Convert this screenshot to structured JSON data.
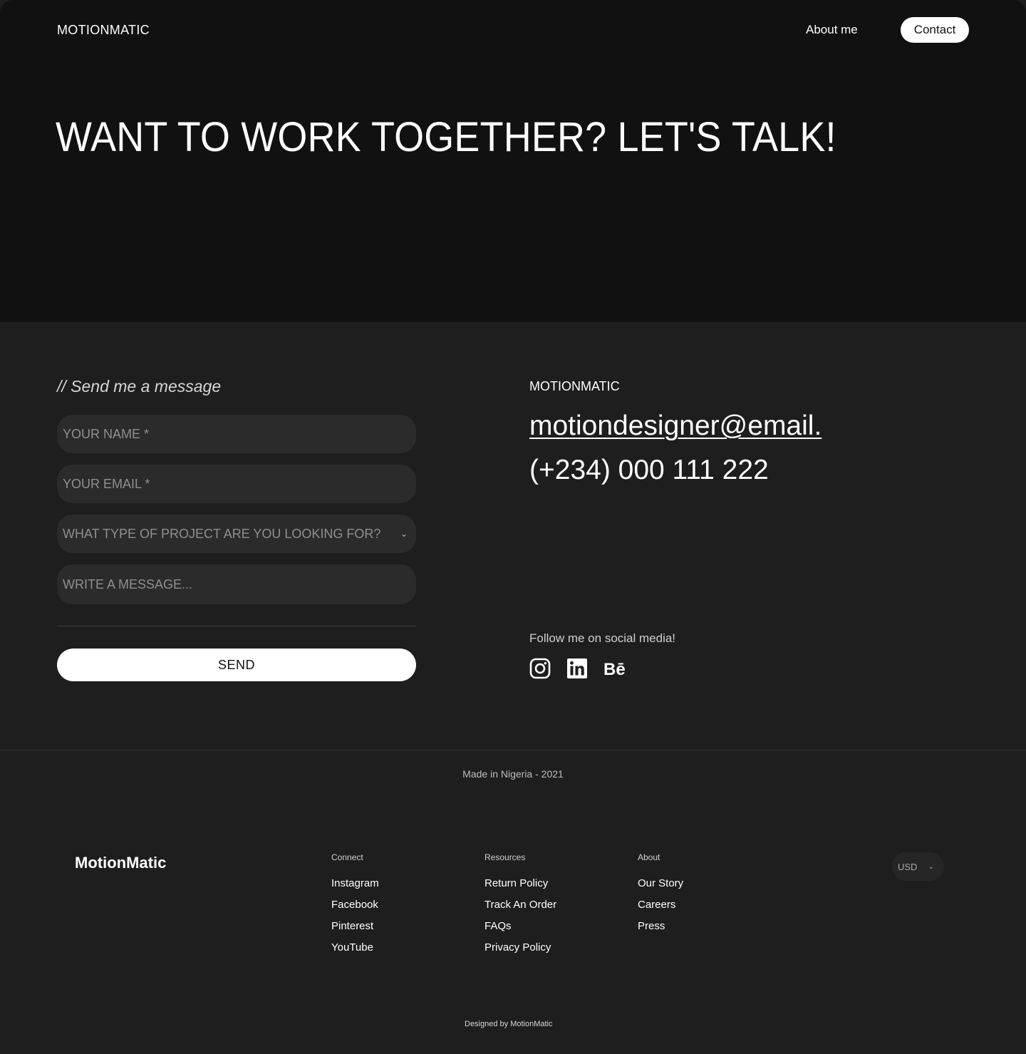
{
  "header": {
    "brand": "MOTIONMATIC",
    "nav_about": "About me",
    "nav_contact": "Contact"
  },
  "hero": {
    "title": "WANT TO WORK TOGETHER? LET'S TALK!"
  },
  "form": {
    "title": "// Send me a message",
    "name_placeholder": "YOUR NAME *",
    "email_placeholder": "YOUR EMAIL *",
    "project_placeholder": "WHAT TYPE OF PROJECT ARE YOU LOOKING FOR?",
    "message_placeholder": "WRITE A MESSAGE...",
    "send_label": "SEND"
  },
  "info": {
    "brand": "MOTIONMATIC",
    "email": "motiondesigner@email.",
    "phone": "(+234) 000 111 222",
    "follow": "Follow me on social media!",
    "socials": [
      "instagram-icon",
      "linkedin-icon",
      "behance-icon"
    ]
  },
  "made_in": "Made in Nigeria - 2021",
  "footer": {
    "brand": "MotionMatic",
    "columns": [
      {
        "heading": "Connect",
        "links": [
          "Instagram",
          "Facebook",
          "Pinterest",
          "YouTube"
        ]
      },
      {
        "heading": "Resources",
        "links": [
          "Return Policy",
          "Track An Order",
          "FAQs",
          "Privacy Policy"
        ]
      },
      {
        "heading": "About",
        "links": [
          "Our Story",
          "Careers",
          "Press"
        ]
      }
    ],
    "currency": "USD",
    "designed_by": "Designed by MotionMatic"
  },
  "colors": {
    "hero_bg": "#111111",
    "page_bg": "#1e1e1e",
    "field_bg": "#2b2b2b",
    "accent": "#ffffff"
  }
}
